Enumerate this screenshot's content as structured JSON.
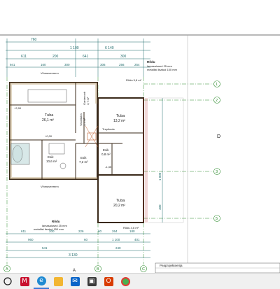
{
  "drawing": {
    "rooms": [
      {
        "name": "Tuba",
        "area": "26,1 m²"
      },
      {
        "name": "Tuba",
        "area": "13,2 m²"
      },
      {
        "name": "Tuba",
        "area": "20,2 m²"
      },
      {
        "name": "Esik",
        "area": "7,2 m²"
      },
      {
        "name": "Esik",
        "area": "0,8 m²"
      },
      {
        "name": "Esik",
        "area": "10,6 m²"
      },
      {
        "name": "Garderoob",
        "area": "3,7 m²"
      },
      {
        "name": "Vannituba",
        "area": "2,1 m²"
      }
    ],
    "balconies": [
      {
        "title": "Rõdu",
        "line1": "lamasaiused 25 mm",
        "line2": "metallist lisatud 150 mm"
      },
      {
        "title": "Rõdu",
        "line1": "lamasaiused 25 mm",
        "line2": "metallist lisatud 150 mm"
      }
    ],
    "balcony_areas": [
      "Rõdu 5,8 m²",
      "Rõdu 4,6 m²"
    ],
    "axis_numbers": [
      "1",
      "2",
      "3",
      "5"
    ],
    "axis_letters_bottom": [
      "A",
      "B",
      "C"
    ],
    "section_letter": "D",
    "top_dims_row1": [
      "760",
      "1 100",
      "6 140"
    ],
    "top_dims_row2": [
      "611",
      "200",
      "641",
      "300"
    ],
    "top_dims_row3": [
      "941",
      "160",
      "300",
      "306",
      "256",
      "254"
    ],
    "bottom_dims_row1": [
      "611",
      "200",
      "226",
      "60",
      "264",
      "180"
    ],
    "bottom_dims_row2": [
      "960",
      "60",
      "1 100",
      "401"
    ],
    "bottom_dims_row3": [
      "541",
      "240"
    ],
    "bottom_total": "3 130",
    "right_dims": [
      "1 000",
      "400"
    ],
    "level_label": "Vihmaveerenn",
    "level_label2": "Vihmaveerenn",
    "stair_label": "Trepikoda",
    "stamp_title": "Peaprojekteerija",
    "misc_small": [
      "+2,90",
      "+0,00",
      "-1,35"
    ]
  },
  "taskbar": {
    "icons": [
      "start-icon",
      "search-icon",
      "mcafee-icon",
      "edge-icon",
      "file-explorer-icon",
      "mail-icon",
      "store-icon",
      "office-icon",
      "chrome-icon"
    ]
  }
}
